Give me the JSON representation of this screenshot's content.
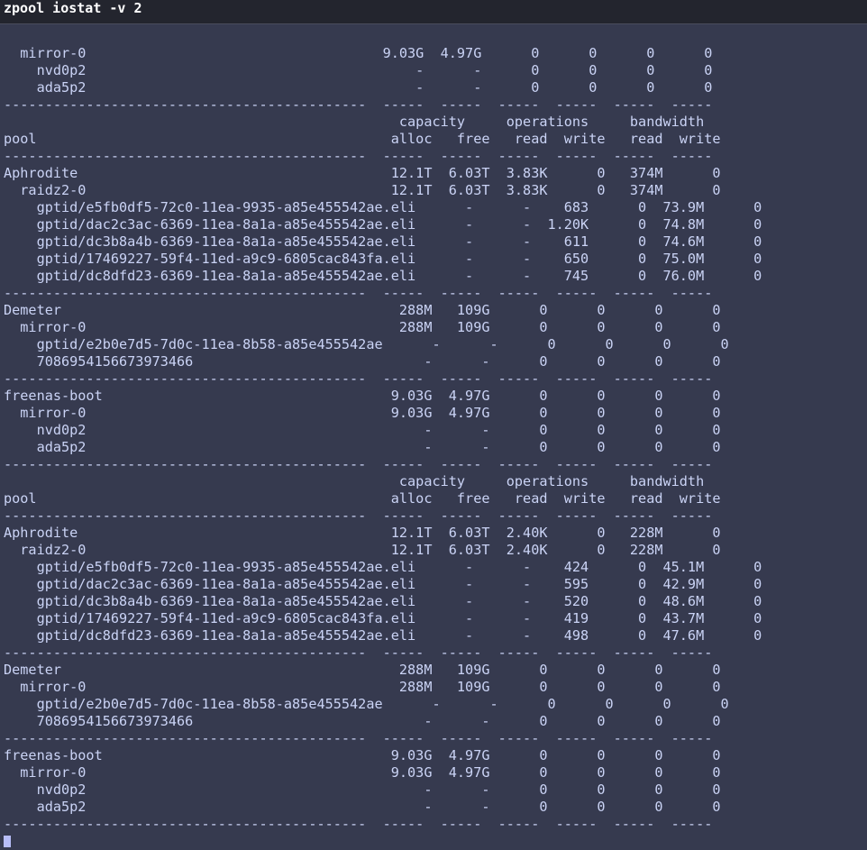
{
  "window": {
    "title": "zpool iostat -v 2"
  },
  "terminal": {
    "lines": [
      "  mirror-0                                    9.03G  4.97G      0      0      0      0",
      "    nvd0p2                                        -      -      0      0      0      0",
      "    ada5p2                                        -      -      0      0      0      0",
      "--------------------------------------------  -----  -----  -----  -----  -----  -----",
      "                                                capacity     operations     bandwidth",
      "pool                                           alloc   free   read  write   read  write",
      "--------------------------------------------  -----  -----  -----  -----  -----  -----",
      "Aphrodite                                      12.1T  6.03T  3.83K      0   374M      0",
      "  raidz2-0                                     12.1T  6.03T  3.83K      0   374M      0",
      "    gptid/e5fb0df5-72c0-11ea-9935-a85e455542ae.eli      -      -    683      0  73.9M      0",
      "    gptid/dac2c3ac-6369-11ea-8a1a-a85e455542ae.eli      -      -  1.20K      0  74.8M      0",
      "    gptid/dc3b8a4b-6369-11ea-8a1a-a85e455542ae.eli      -      -    611      0  74.6M      0",
      "    gptid/17469227-59f4-11ed-a9c9-6805cac843fa.eli      -      -    650      0  75.0M      0",
      "    gptid/dc8dfd23-6369-11ea-8a1a-a85e455542ae.eli      -      -    745      0  76.0M      0",
      "--------------------------------------------  -----  -----  -----  -----  -----  -----",
      "Demeter                                         288M   109G      0      0      0      0",
      "  mirror-0                                      288M   109G      0      0      0      0",
      "    gptid/e2b0e7d5-7d0c-11ea-8b58-a85e455542ae      -      -      0      0      0      0",
      "    7086954156673973466                            -      -      0      0      0      0",
      "--------------------------------------------  -----  -----  -----  -----  -----  -----",
      "freenas-boot                                   9.03G  4.97G      0      0      0      0",
      "  mirror-0                                     9.03G  4.97G      0      0      0      0",
      "    nvd0p2                                         -      -      0      0      0      0",
      "    ada5p2                                         -      -      0      0      0      0",
      "--------------------------------------------  -----  -----  -----  -----  -----  -----",
      "                                                capacity     operations     bandwidth",
      "pool                                           alloc   free   read  write   read  write",
      "--------------------------------------------  -----  -----  -----  -----  -----  -----",
      "Aphrodite                                      12.1T  6.03T  2.40K      0   228M      0",
      "  raidz2-0                                     12.1T  6.03T  2.40K      0   228M      0",
      "    gptid/e5fb0df5-72c0-11ea-9935-a85e455542ae.eli      -      -    424      0  45.1M      0",
      "    gptid/dac2c3ac-6369-11ea-8a1a-a85e455542ae.eli      -      -    595      0  42.9M      0",
      "    gptid/dc3b8a4b-6369-11ea-8a1a-a85e455542ae.eli      -      -    520      0  48.6M      0",
      "    gptid/17469227-59f4-11ed-a9c9-6805cac843fa.eli      -      -    419      0  43.7M      0",
      "    gptid/dc8dfd23-6369-11ea-8a1a-a85e455542ae.eli      -      -    498      0  47.6M      0",
      "--------------------------------------------  -----  -----  -----  -----  -----  -----",
      "Demeter                                         288M   109G      0      0      0      0",
      "  mirror-0                                      288M   109G      0      0      0      0",
      "    gptid/e2b0e7d5-7d0c-11ea-8b58-a85e455542ae      -      -      0      0      0      0",
      "    7086954156673973466                            -      -      0      0      0      0",
      "--------------------------------------------  -----  -----  -----  -----  -----  -----",
      "freenas-boot                                   9.03G  4.97G      0      0      0      0",
      "  mirror-0                                     9.03G  4.97G      0      0      0      0",
      "    nvd0p2                                         -      -      0      0      0      0",
      "    ada5p2                                         -      -      0      0      0      0",
      "--------------------------------------------  -----  -----  -----  -----  -----  -----"
    ]
  },
  "colors": {
    "background": "#363a4f",
    "titlebar": "#23252e",
    "text": "#cad3f5",
    "cursor": "#b7bdf8"
  }
}
